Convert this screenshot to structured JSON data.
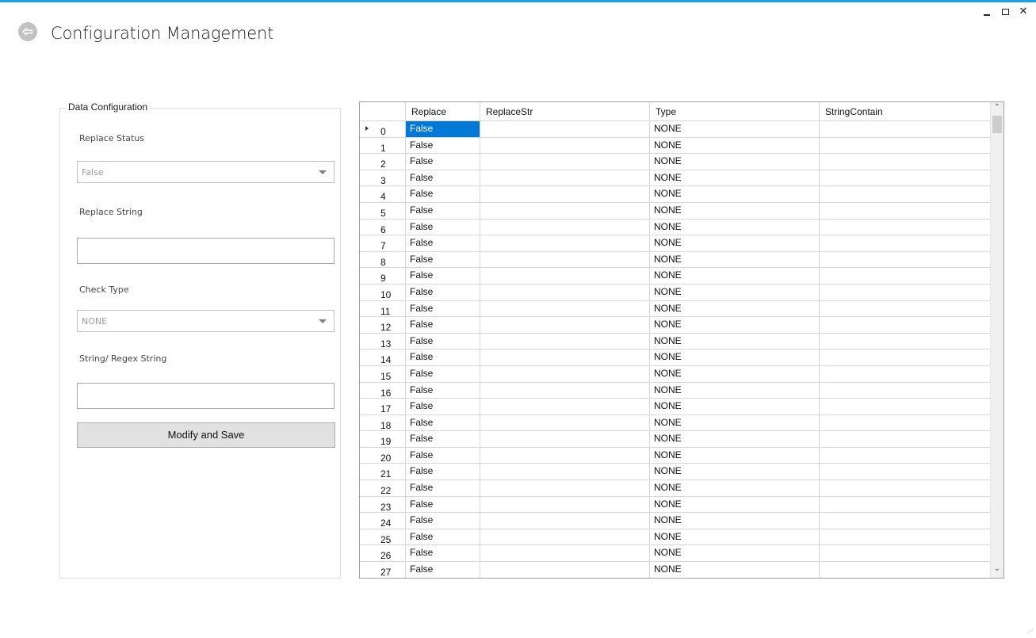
{
  "window": {
    "title": "Configuration Management",
    "controls": {
      "minimize": "minimize-icon",
      "maximize": "maximize-icon",
      "close": "close-icon",
      "close_glyph": "✕"
    },
    "accent": "#1ba1e2"
  },
  "back": {
    "icon": "back-arrow-icon",
    "glyph": "⇦"
  },
  "form": {
    "legend": "Data Configuration",
    "replace_status_label": "Replace Status",
    "replace_status_value": "False",
    "replace_string_label": "Replace String",
    "replace_string_value": "",
    "check_type_label": "Check Type",
    "check_type_value": "NONE",
    "regex_label": "String/ Regex String",
    "regex_value": "",
    "save_label": "Modify and Save"
  },
  "grid": {
    "columns": [
      "Replace",
      "ReplaceStr",
      "Type",
      "StringContain"
    ],
    "selected_row": 0,
    "selected_col": 0,
    "scroll": {
      "up_glyph": "⌃",
      "down_glyph": "⌄"
    },
    "rows": [
      {
        "index": "0",
        "replace": "False",
        "replace_str": "",
        "type": "NONE",
        "string_contain": ""
      },
      {
        "index": "1",
        "replace": "False",
        "replace_str": "",
        "type": "NONE",
        "string_contain": ""
      },
      {
        "index": "2",
        "replace": "False",
        "replace_str": "",
        "type": "NONE",
        "string_contain": ""
      },
      {
        "index": "3",
        "replace": "False",
        "replace_str": "",
        "type": "NONE",
        "string_contain": ""
      },
      {
        "index": "4",
        "replace": "False",
        "replace_str": "",
        "type": "NONE",
        "string_contain": ""
      },
      {
        "index": "5",
        "replace": "False",
        "replace_str": "",
        "type": "NONE",
        "string_contain": ""
      },
      {
        "index": "6",
        "replace": "False",
        "replace_str": "",
        "type": "NONE",
        "string_contain": ""
      },
      {
        "index": "7",
        "replace": "False",
        "replace_str": "",
        "type": "NONE",
        "string_contain": ""
      },
      {
        "index": "8",
        "replace": "False",
        "replace_str": "",
        "type": "NONE",
        "string_contain": ""
      },
      {
        "index": "9",
        "replace": "False",
        "replace_str": "",
        "type": "NONE",
        "string_contain": ""
      },
      {
        "index": "10",
        "replace": "False",
        "replace_str": "",
        "type": "NONE",
        "string_contain": ""
      },
      {
        "index": "11",
        "replace": "False",
        "replace_str": "",
        "type": "NONE",
        "string_contain": ""
      },
      {
        "index": "12",
        "replace": "False",
        "replace_str": "",
        "type": "NONE",
        "string_contain": ""
      },
      {
        "index": "13",
        "replace": "False",
        "replace_str": "",
        "type": "NONE",
        "string_contain": ""
      },
      {
        "index": "14",
        "replace": "False",
        "replace_str": "",
        "type": "NONE",
        "string_contain": ""
      },
      {
        "index": "15",
        "replace": "False",
        "replace_str": "",
        "type": "NONE",
        "string_contain": ""
      },
      {
        "index": "16",
        "replace": "False",
        "replace_str": "",
        "type": "NONE",
        "string_contain": ""
      },
      {
        "index": "17",
        "replace": "False",
        "replace_str": "",
        "type": "NONE",
        "string_contain": ""
      },
      {
        "index": "18",
        "replace": "False",
        "replace_str": "",
        "type": "NONE",
        "string_contain": ""
      },
      {
        "index": "19",
        "replace": "False",
        "replace_str": "",
        "type": "NONE",
        "string_contain": ""
      },
      {
        "index": "20",
        "replace": "False",
        "replace_str": "",
        "type": "NONE",
        "string_contain": ""
      },
      {
        "index": "21",
        "replace": "False",
        "replace_str": "",
        "type": "NONE",
        "string_contain": ""
      },
      {
        "index": "22",
        "replace": "False",
        "replace_str": "",
        "type": "NONE",
        "string_contain": ""
      },
      {
        "index": "23",
        "replace": "False",
        "replace_str": "",
        "type": "NONE",
        "string_contain": ""
      },
      {
        "index": "24",
        "replace": "False",
        "replace_str": "",
        "type": "NONE",
        "string_contain": ""
      },
      {
        "index": "25",
        "replace": "False",
        "replace_str": "",
        "type": "NONE",
        "string_contain": ""
      },
      {
        "index": "26",
        "replace": "False",
        "replace_str": "",
        "type": "NONE",
        "string_contain": ""
      },
      {
        "index": "27",
        "replace": "False",
        "replace_str": "",
        "type": "NONE",
        "string_contain": ""
      }
    ]
  },
  "colors": {
    "selection": "#0078d7",
    "button": "#e1e1e1"
  }
}
